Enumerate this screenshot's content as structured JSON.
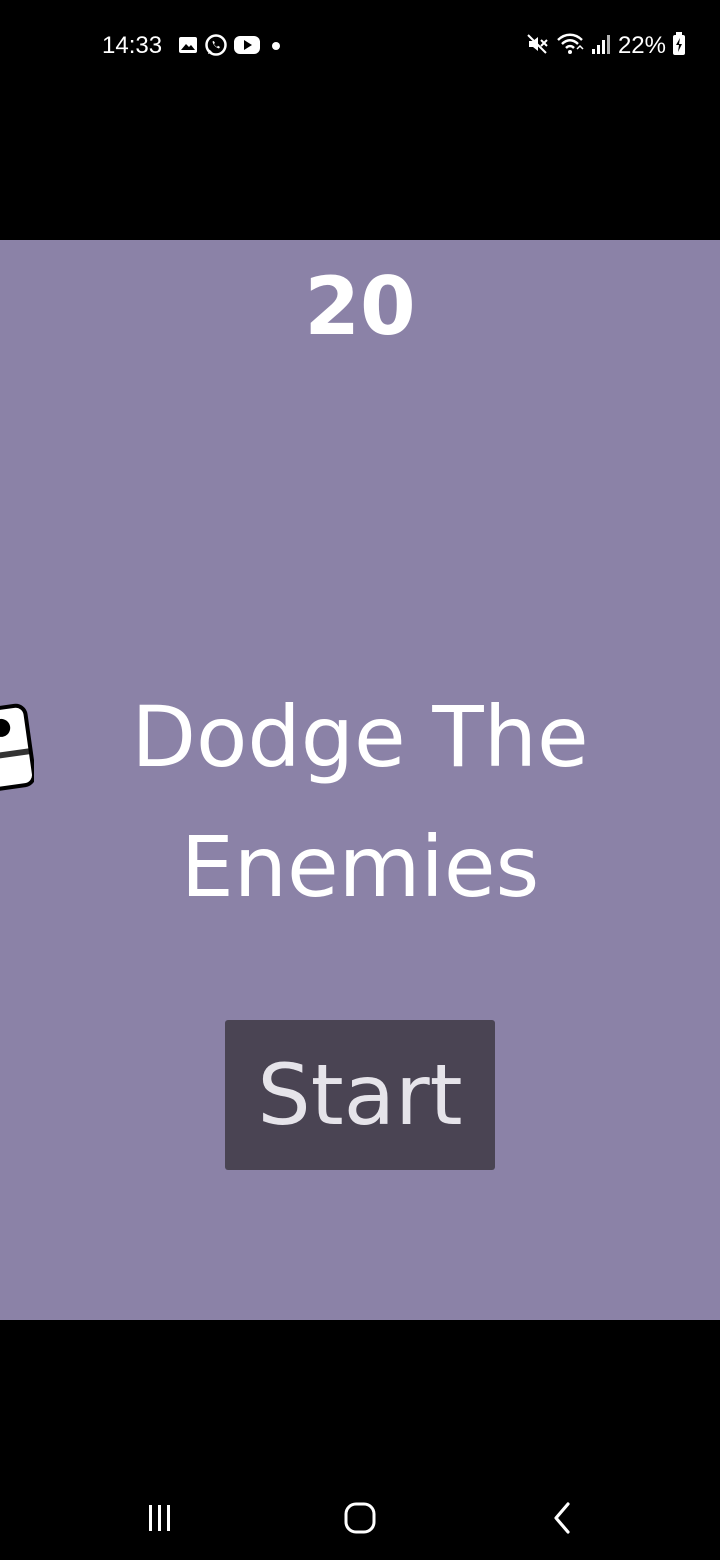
{
  "status_bar": {
    "time": "14:33",
    "battery_percent": "22%",
    "left_icons": [
      "gallery-icon",
      "whatsapp-icon",
      "youtube-icon",
      "notification-dot-icon"
    ],
    "right_icons": [
      "mute-icon",
      "wifi-icon",
      "signal-icon",
      "battery-charging-icon"
    ]
  },
  "game": {
    "score": "20",
    "title": "Dodge The\nEnemies",
    "start_label": "Start",
    "colors": {
      "background": "#8B82A7",
      "button": "#4A4453",
      "text": "#FFFFFF"
    },
    "enemy_icon": "enemy-sprite-icon"
  },
  "nav_bar": {
    "buttons": [
      "recent-apps-icon",
      "home-icon",
      "back-icon"
    ]
  }
}
